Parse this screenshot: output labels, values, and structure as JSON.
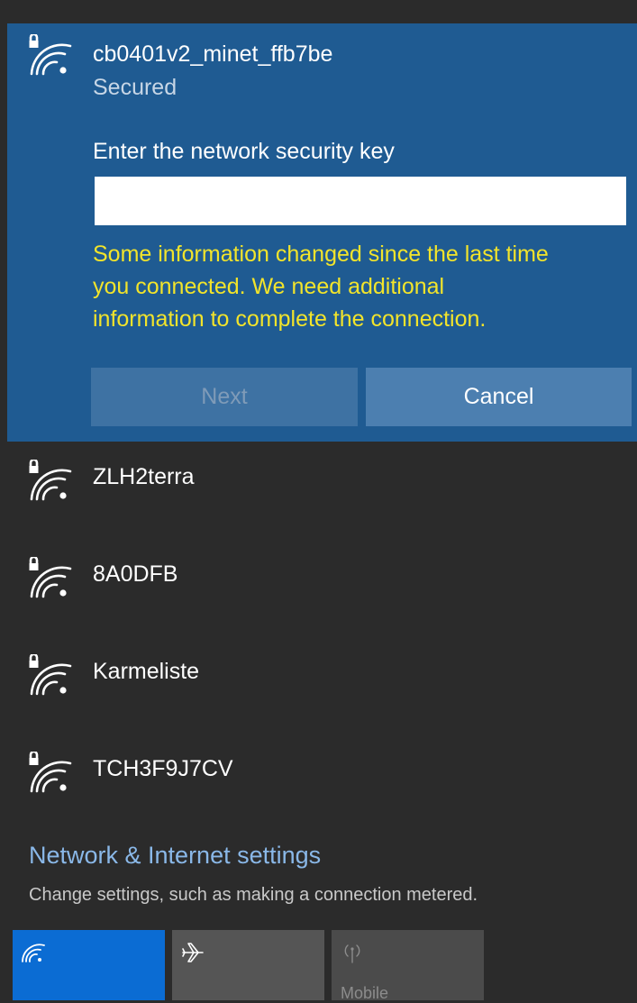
{
  "selected_network": {
    "name": "cb0401v2_minet_ffb7be",
    "status": "Secured",
    "prompt": "Enter the network security key",
    "key_value": "",
    "warning_lines": [
      "Some information changed since the last time",
      "you connected. We need additional",
      "information to complete the connection."
    ],
    "next_label": "Next",
    "cancel_label": "Cancel"
  },
  "networks": [
    {
      "name": "ZLH2terra",
      "icon": "secured-wifi-icon"
    },
    {
      "name": "8A0DFB",
      "icon": "secured-wifi-icon"
    },
    {
      "name": "Karmeliste",
      "icon": "secured-wifi-icon"
    },
    {
      "name": "TCH3F9J7CV",
      "icon": "secured-wifi-icon"
    }
  ],
  "settings": {
    "link_label": "Network & Internet settings",
    "description": "Change settings, such as making a connection metered."
  },
  "quick_actions": [
    {
      "icon": "wifi-icon",
      "label": "",
      "active": true
    },
    {
      "icon": "airplane-icon",
      "label": "",
      "active": false
    },
    {
      "icon": "mobile-hotspot-icon",
      "label": "Mobile",
      "active": false
    }
  ],
  "colors": {
    "panel_bg": "#2b2b2b",
    "selected_bg": "#1f5b92",
    "warning": "#f2e42b",
    "link": "#8ab8e8",
    "active_tile": "#0b6cd3"
  }
}
